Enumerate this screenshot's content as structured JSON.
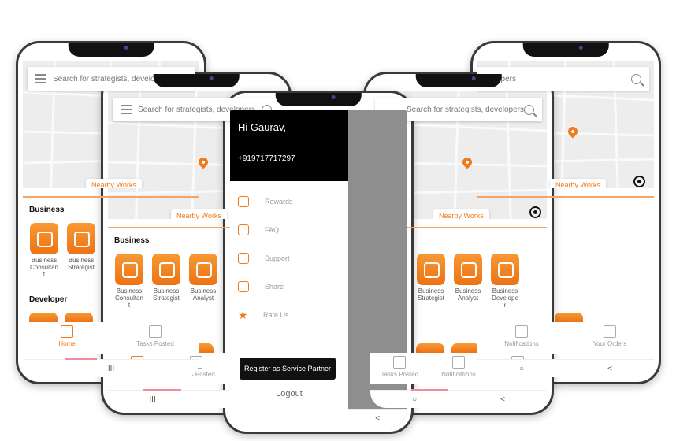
{
  "search": {
    "placeholder": "Search for strategists, developers"
  },
  "sections": {
    "business": "Business",
    "developer": "Developer"
  },
  "nearby": "Nearby Works",
  "services": {
    "consultant": "Business Consultan t",
    "strategist": "Business Strategist",
    "analyst": "Business Analyst",
    "developer": "Business Develope r"
  },
  "nav": {
    "home": "Home",
    "tasks": "Tasks Posted",
    "notifications": "Notifications",
    "orders": "Your Orders"
  },
  "sysnav": {
    "recent": "III",
    "home": "○",
    "back": "<"
  },
  "drawer": {
    "greeting": "Hi Gaurav,",
    "phone": "+919717717297",
    "items": [
      "Rewards",
      "FAQ",
      "Support",
      "Share",
      "Rate Us"
    ],
    "register": "Register as  Service Partner",
    "logout": "Logout"
  },
  "colors": {
    "accent": "#f07b1d",
    "dark": "#111111"
  }
}
